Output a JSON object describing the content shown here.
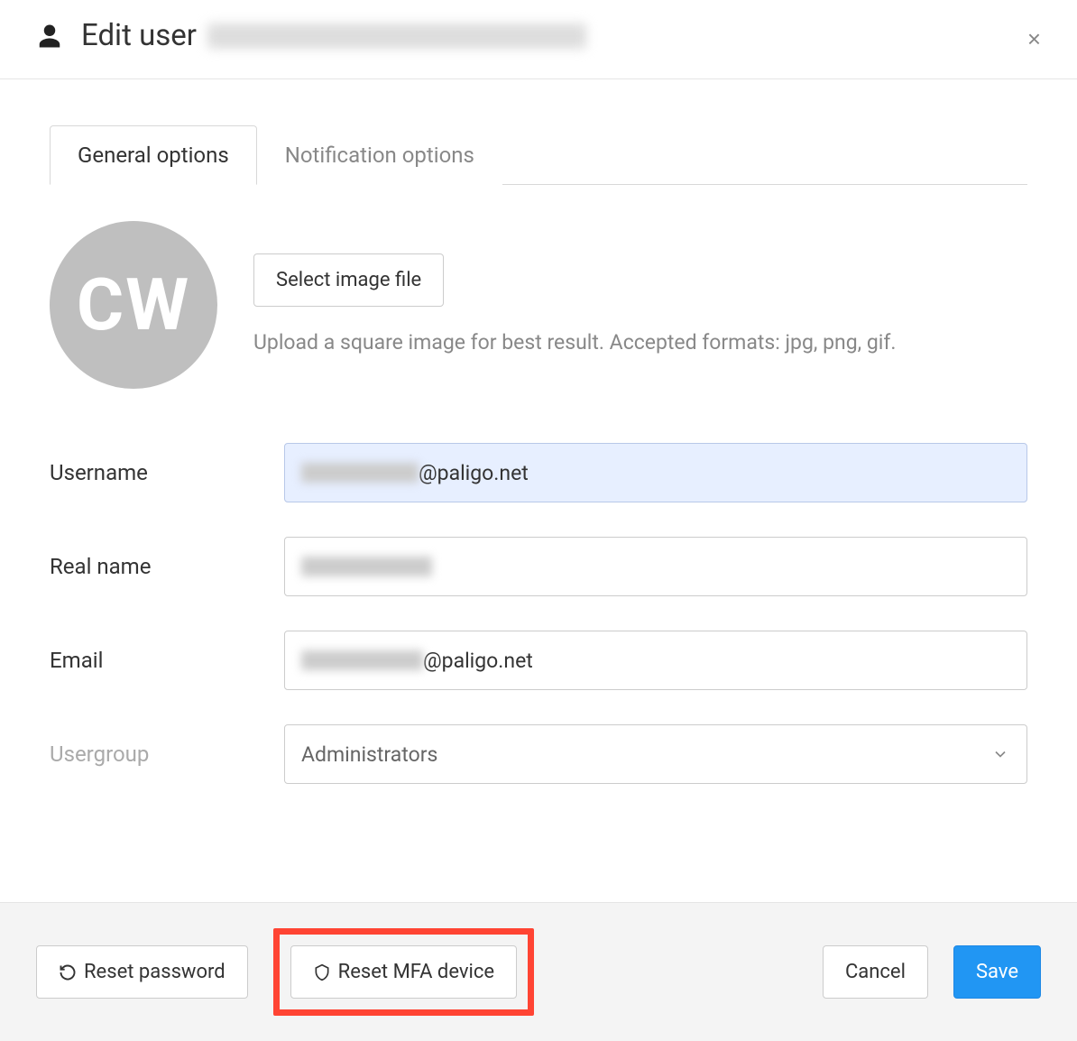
{
  "header": {
    "title_prefix": "Edit user",
    "user_email_redacted": true,
    "close_label": "×"
  },
  "tabs": {
    "general": "General options",
    "notifications": "Notification options",
    "active": "general"
  },
  "avatar": {
    "initials": "CW",
    "select_image_label": "Select image file",
    "help": "Upload a square image for best result. Accepted formats: jpg, png, gif."
  },
  "form": {
    "username_label": "Username",
    "username_suffix": "@paligo.net",
    "username_prefix_redacted": true,
    "realname_label": "Real name",
    "realname_redacted": true,
    "email_label": "Email",
    "email_suffix": "@paligo.net",
    "email_prefix_redacted": true,
    "usergroup_label": "Usergroup",
    "usergroup_value": "Administrators"
  },
  "footer": {
    "reset_password": "Reset password",
    "reset_mfa": "Reset MFA device",
    "cancel": "Cancel",
    "save": "Save"
  },
  "highlight": "reset_mfa"
}
